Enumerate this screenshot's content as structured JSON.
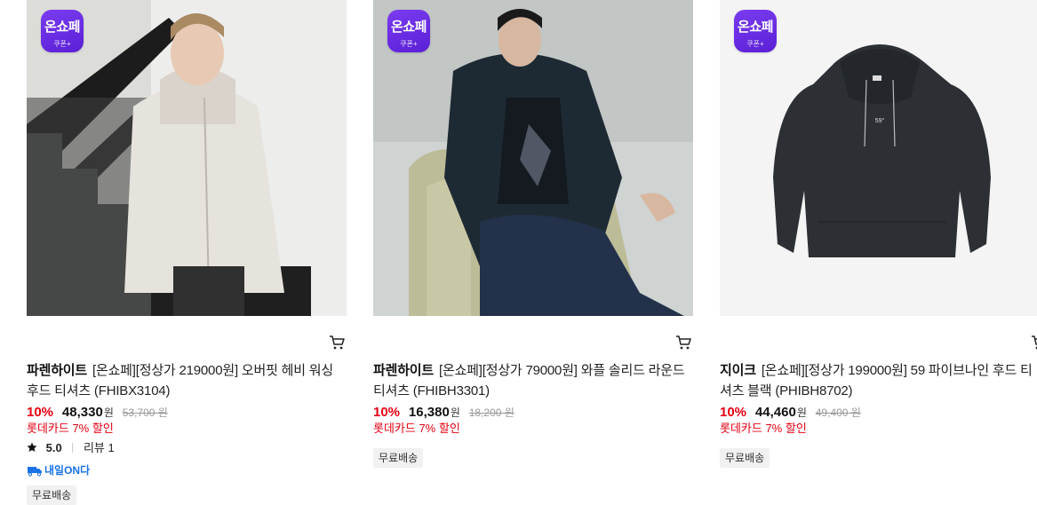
{
  "badge": {
    "main": "온쇼페",
    "sub": "쿠폰+"
  },
  "products": [
    {
      "brand": "파렌하이트",
      "name": "[온쇼페][정상가 219000원] 오버핏 헤비 워싱 후드 티셔츠 (FHIBX3104)",
      "discount": "10%",
      "price": "48,330",
      "currency": "원",
      "original_price": "53,700 원",
      "card_promo": "롯데카드 7% 할인",
      "rating": "5.0",
      "reviews": "리뷰 1",
      "tomorrow_label": "내일ON다",
      "tag": "무료배송"
    },
    {
      "brand": "파렌하이트",
      "name": "[온쇼페][정상가 79000원] 와플 솔리드 라운드 티셔츠 (FHIBH3301)",
      "discount": "10%",
      "price": "16,380",
      "currency": "원",
      "original_price": "18,200 원",
      "card_promo": "롯데카드 7% 할인",
      "tag": "무료배송"
    },
    {
      "brand": "지이크",
      "name": "[온쇼페][정상가 199000원] 59 파이브나인 후드 티셔츠 블랙 (PHIBH8702)",
      "discount": "10%",
      "price": "44,460",
      "currency": "원",
      "original_price": "49,400 원",
      "card_promo": "롯데카드 7% 할인",
      "tag": "무료배송"
    }
  ],
  "colors": {
    "accent": "#e60012",
    "badge": "#6a2ee6",
    "tomorrow": "#1a73e8"
  },
  "icons": [
    "cart-icon",
    "star-icon",
    "truck-icon"
  ]
}
